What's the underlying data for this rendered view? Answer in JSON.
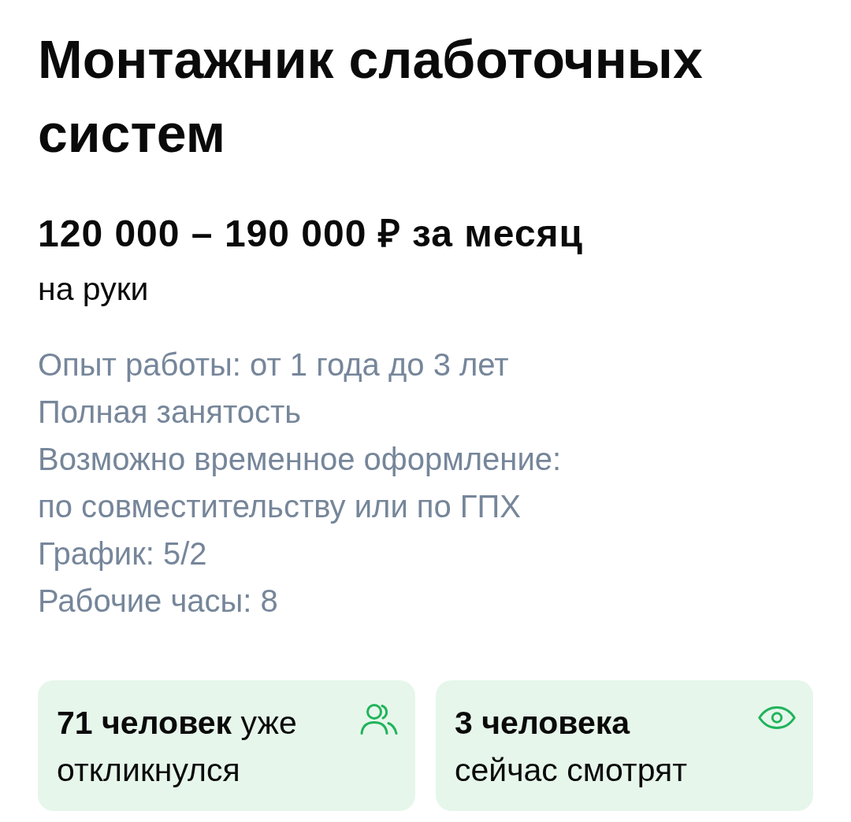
{
  "vacancy": {
    "title": "Монтажник слаботочных систем",
    "salary": "120 000 – 190 000 ₽ за месяц",
    "salary_note": "на руки",
    "details": [
      "Опыт работы: от 1 года до 3 лет",
      "Полная занятость",
      "Возможно временное оформление:",
      "по совместительству или по ГПХ",
      "График: 5/2",
      "Рабочие часы: 8"
    ]
  },
  "stats": [
    {
      "kind": "responses",
      "text": "**71 человек** уже откликнулся"
    },
    {
      "kind": "viewers",
      "text": "**3 человека** сейчас смотрят"
    }
  ]
}
